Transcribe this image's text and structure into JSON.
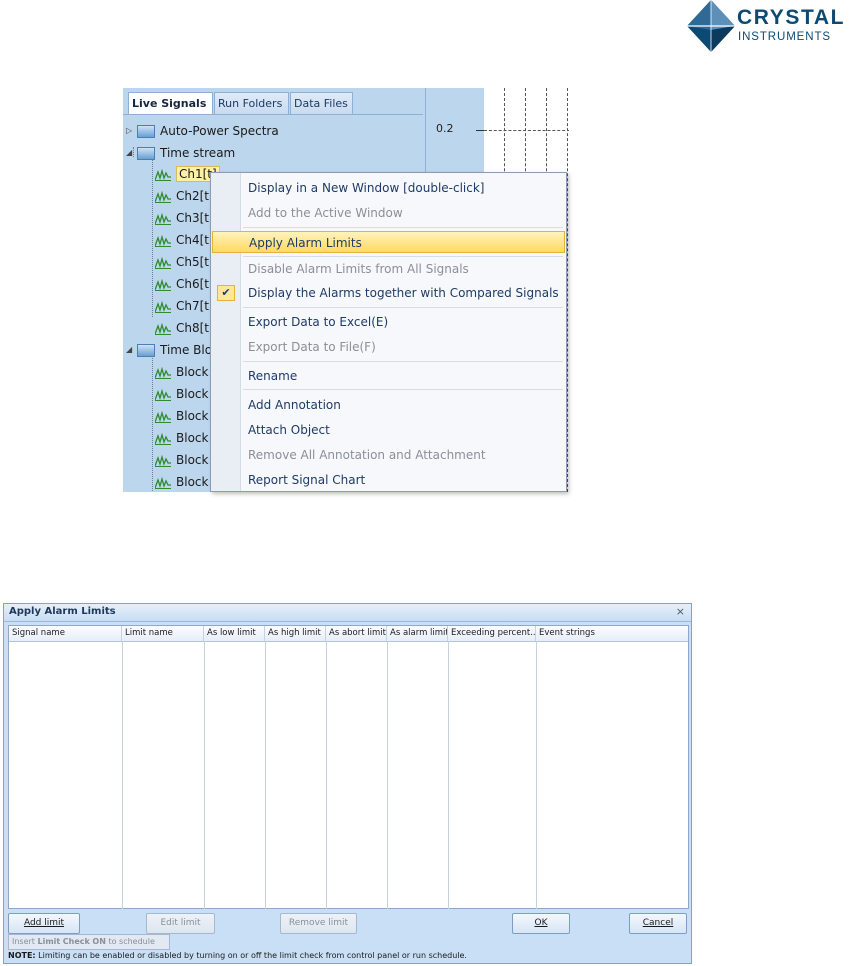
{
  "logo": {
    "line1": "CRYSTAL",
    "line2": "INSTRUMENTS",
    "colors": {
      "dark": "#0d4a73",
      "light": "#5d8fb8"
    }
  },
  "tabs": [
    {
      "label": "Live Signals",
      "active": true
    },
    {
      "label": "Run Folders",
      "active": false
    },
    {
      "label": "Data Files",
      "active": false
    }
  ],
  "tree": {
    "auto_power": "Auto-Power Spectra",
    "time_stream": "Time stream",
    "channels": [
      "Ch1[t]",
      "Ch2[t",
      "Ch3[t",
      "Ch4[t",
      "Ch5[t",
      "Ch6[t",
      "Ch7[t",
      "Ch8[t"
    ],
    "time_block": "Time Blo",
    "blocks": [
      "Block",
      "Block",
      "Block",
      "Block",
      "Block",
      "Block"
    ]
  },
  "chart": {
    "tick_label": "0.2"
  },
  "context_menu": {
    "items": [
      {
        "label": "Display in a New Window [double-click]",
        "disabled": false
      },
      {
        "label": "Add to the Active Window",
        "disabled": true
      },
      {
        "label": "Apply Alarm Limits",
        "disabled": false,
        "highlighted": true
      },
      {
        "label": "Disable Alarm Limits from All Signals",
        "disabled": true
      },
      {
        "label": "Display the Alarms together with Compared Signals",
        "disabled": false,
        "checked": true
      },
      {
        "label": "Export Data to Excel(E)",
        "disabled": false
      },
      {
        "label": "Export Data to File(F)",
        "disabled": true
      },
      {
        "label": "Rename",
        "disabled": false
      },
      {
        "label": "Add Annotation",
        "disabled": false
      },
      {
        "label": "Attach Object",
        "disabled": false
      },
      {
        "label": "Remove All Annotation and Attachment",
        "disabled": true
      },
      {
        "label": "Report Signal Chart",
        "disabled": false
      }
    ],
    "check_glyph": "✔"
  },
  "dialog": {
    "title": "Apply Alarm Limits",
    "close": "×",
    "columns": [
      "Signal name",
      "Limit name",
      "As low limit",
      "As high limit",
      "As abort limit",
      "As alarm limit",
      "Exceeding percent...",
      "Event strings"
    ],
    "buttons": {
      "add": "Add limit",
      "edit": "Edit limit",
      "remove": "Remove limit",
      "ok": "OK",
      "cancel": "Cancel"
    },
    "insert": {
      "prefix": "Insert ",
      "bold1": "Limit",
      "mid": " ",
      "bold2": "Check",
      "mid2": " ",
      "bold3": "ON",
      "suffix": " to schedule"
    },
    "note": {
      "label": "NOTE:",
      "text": " Limiting can be enabled or disabled by turning on or off the limit check from control panel or run schedule."
    }
  }
}
